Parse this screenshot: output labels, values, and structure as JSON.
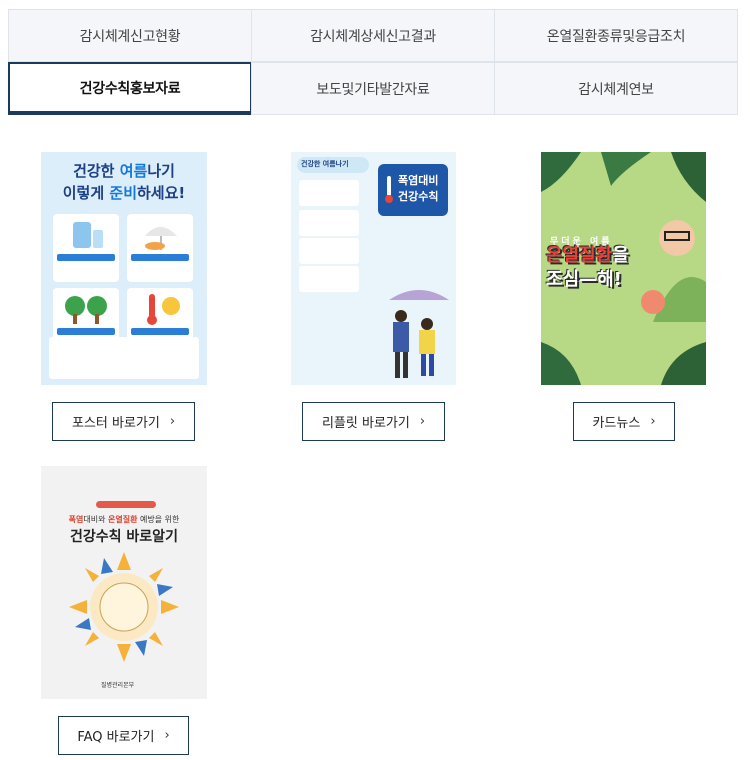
{
  "tabs": [
    {
      "label": "감시체계신고현황"
    },
    {
      "label": "감시체계상세신고결과"
    },
    {
      "label": "온열질환종류및응급조치"
    },
    {
      "label": "건강수칙홍보자료"
    },
    {
      "label": "보도및기타발간자료"
    },
    {
      "label": "감시체계연보"
    }
  ],
  "active_tab": "건강수칙홍보자료",
  "cards": {
    "poster": {
      "button_label": "포스터 바로가기",
      "headline_1": "건강한",
      "headline_2": "여름",
      "headline_3": "나기",
      "headline_4": "이렇게",
      "headline_5": "준비",
      "headline_6": "하세요!"
    },
    "leaflet": {
      "button_label": "리플릿 바로가기",
      "tag": "건강한 여름나기",
      "title_1": "폭염대비",
      "title_2": "건강수칙"
    },
    "cardnews": {
      "button_label": "카드뉴스",
      "line_1": "무더운 여름",
      "line_2a": "온열질환",
      "line_2b": "을",
      "line_3": "조심—해!"
    },
    "faq": {
      "button_label": "FAQ 바로가기",
      "sub_a": "폭염",
      "sub_b": "대비와 ",
      "sub_c": "온열질환",
      "sub_d": " 예방을 위한",
      "main": "건강수칙 바로알기",
      "org": "질병관리본부"
    }
  },
  "colors": {
    "accent_navy": "#1b3a5c",
    "tab_bg": "#f4f6f9",
    "tab_border": "#dfe3ea"
  },
  "icons": {
    "chevron": "chevron-right-icon"
  }
}
